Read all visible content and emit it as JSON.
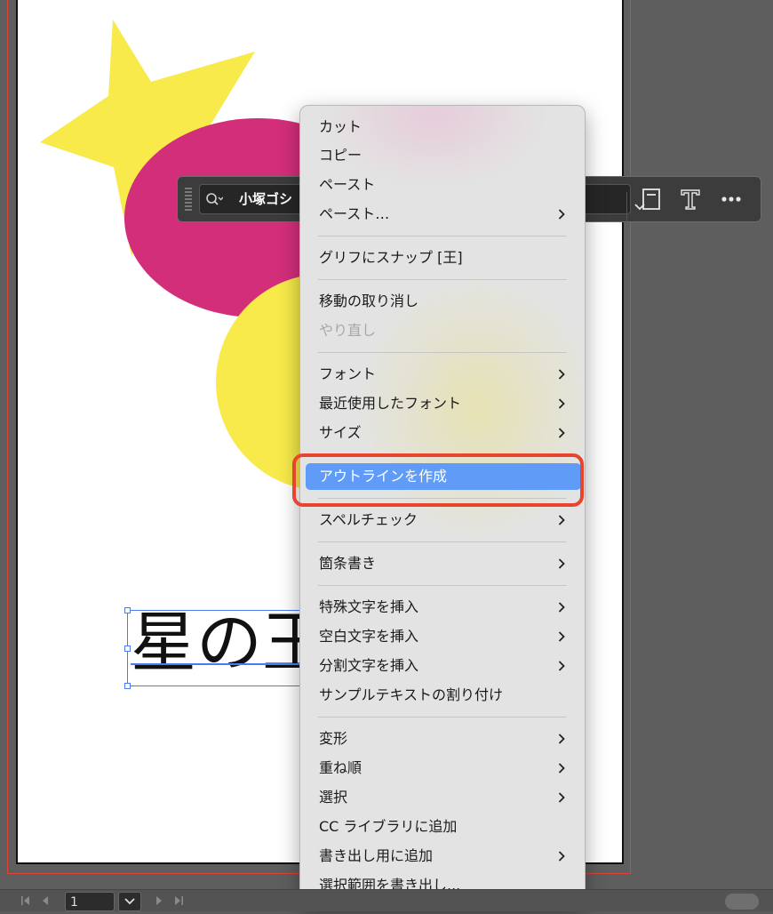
{
  "canvas": {
    "sample_text": "星の王"
  },
  "colors": {
    "star": "#f7ea4a",
    "magenta_ellipse": "#d32e7a",
    "yellow_circle": "#f7ea4a",
    "menu_highlight": "#5f9bf7",
    "callout": "#e8452e",
    "selection": "#4a7cf0"
  },
  "toolbar": {
    "font_name": "小塚ゴシ",
    "icons": [
      "search-icon",
      "chevron-down-icon",
      "text-frame-icon",
      "type-icon",
      "more-icon"
    ]
  },
  "context_menu": {
    "items": [
      {
        "label": "カット"
      },
      {
        "label": "コピー"
      },
      {
        "label": "ペースト"
      },
      {
        "label": "ペースト…",
        "submenu": true
      },
      {
        "label": "グリフにスナップ [王]"
      },
      {
        "label": "移動の取り消し"
      },
      {
        "label": "やり直し",
        "disabled": true
      },
      {
        "label": "フォント",
        "submenu": true
      },
      {
        "label": "最近使用したフォント",
        "submenu": true
      },
      {
        "label": "サイズ",
        "submenu": true
      },
      {
        "label": "アウトラインを作成",
        "highlighted": true
      },
      {
        "label": "スペルチェック",
        "submenu": true
      },
      {
        "label": "箇条書き",
        "submenu": true
      },
      {
        "label": "特殊文字を挿入",
        "submenu": true
      },
      {
        "label": "空白文字を挿入",
        "submenu": true
      },
      {
        "label": "分割文字を挿入",
        "submenu": true
      },
      {
        "label": "サンプルテキストの割り付け"
      },
      {
        "label": "変形",
        "submenu": true
      },
      {
        "label": "重ね順",
        "submenu": true
      },
      {
        "label": "選択",
        "submenu": true
      },
      {
        "label": "CC ライブラリに追加"
      },
      {
        "label": "書き出し用に追加",
        "submenu": true
      },
      {
        "label": "選択範囲を書き出し..."
      }
    ]
  },
  "status_bar": {
    "page_number": "1"
  }
}
